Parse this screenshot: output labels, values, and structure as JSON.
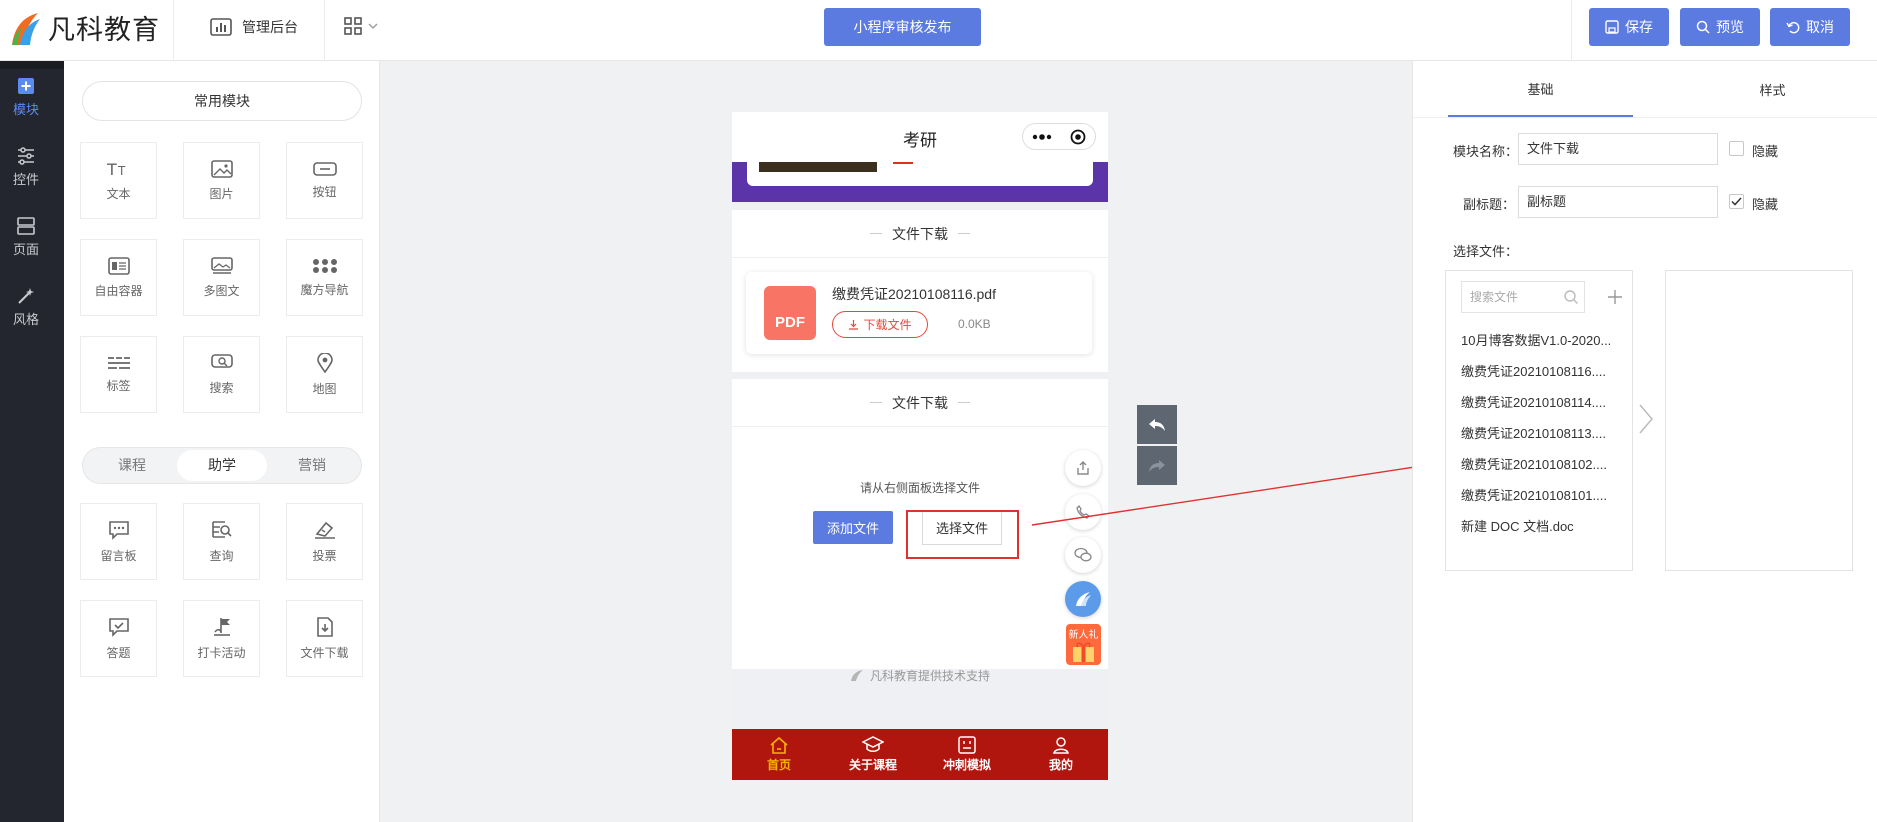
{
  "header": {
    "brand": "凡科教育",
    "admin_label": "管理后台",
    "publish_label": "小程序审核发布",
    "save_label": "保存",
    "preview_label": "预览",
    "cancel_label": "取消"
  },
  "sidebar": {
    "items": [
      {
        "label": "模块",
        "icon": "plus-square-icon",
        "active": true
      },
      {
        "label": "控件",
        "icon": "sliders-icon"
      },
      {
        "label": "页面",
        "icon": "pages-icon"
      },
      {
        "label": "风格",
        "icon": "magic-wand-icon"
      }
    ]
  },
  "modules": {
    "common_title": "常用模块",
    "common": [
      {
        "label": "文本",
        "icon": "text-icon"
      },
      {
        "label": "图片",
        "icon": "image-icon"
      },
      {
        "label": "按钮",
        "icon": "button-icon"
      },
      {
        "label": "自由容器",
        "icon": "container-icon"
      },
      {
        "label": "多图文",
        "icon": "multi-image-icon"
      },
      {
        "label": "魔方导航",
        "icon": "dots-grid-icon"
      },
      {
        "label": "标签",
        "icon": "tags-icon"
      },
      {
        "label": "搜索",
        "icon": "search-icon"
      },
      {
        "label": "地图",
        "icon": "map-pin-icon"
      }
    ],
    "segments": [
      "课程",
      "助学",
      "营销"
    ],
    "segment_active": "助学",
    "study": [
      {
        "label": "留言板",
        "icon": "message-board-icon"
      },
      {
        "label": "查询",
        "icon": "query-icon"
      },
      {
        "label": "投票",
        "icon": "vote-icon"
      },
      {
        "label": "答题",
        "icon": "answer-icon"
      },
      {
        "label": "打卡活动",
        "icon": "checkin-flag-icon"
      },
      {
        "label": "文件下载",
        "icon": "file-download-icon"
      }
    ]
  },
  "phone": {
    "title": "考研",
    "section1_title": "文件下载",
    "file": {
      "name": "缴费凭证20210108116.pdf",
      "badge": "PDF",
      "download_label": "下载文件",
      "size": "0.0KB"
    },
    "section2_title": "文件下载",
    "hint": "请从右侧面板选择文件",
    "add_label": "添加文件",
    "select_label": "选择文件",
    "gift_label": "新人礼",
    "tech_support": "凡科教育提供技术支持",
    "tabs": [
      {
        "label": "首页",
        "icon": "home-icon",
        "active": true
      },
      {
        "label": "关于课程",
        "icon": "graduation-cap-icon"
      },
      {
        "label": "冲刺模拟",
        "icon": "exam-icon"
      },
      {
        "label": "我的",
        "icon": "user-icon"
      }
    ]
  },
  "panel": {
    "tabs": [
      "基础",
      "样式"
    ],
    "active_tab": "基础",
    "module_name_label": "模块名称：",
    "module_name_value": "文件下载",
    "module_name_hidden": false,
    "subtitle_label": "副标题：",
    "subtitle_value": "副标题",
    "subtitle_hidden": true,
    "hide_label": "隐藏",
    "select_files_label": "选择文件：",
    "search_placeholder": "搜索文件",
    "files": [
      "10月博客数据V1.0-2020...",
      "缴费凭证20210108116....",
      "缴费凭证20210108114....",
      "缴费凭证20210108113....",
      "缴费凭证20210108102....",
      "缴费凭证20210108101....",
      "新建 DOC 文档.doc"
    ]
  },
  "colors": {
    "accent": "#5b7be0",
    "tabbar": "#b0160d",
    "tab_active": "#f6b400",
    "annotation": "#e03131",
    "purple_banner": "#5a34a8"
  }
}
